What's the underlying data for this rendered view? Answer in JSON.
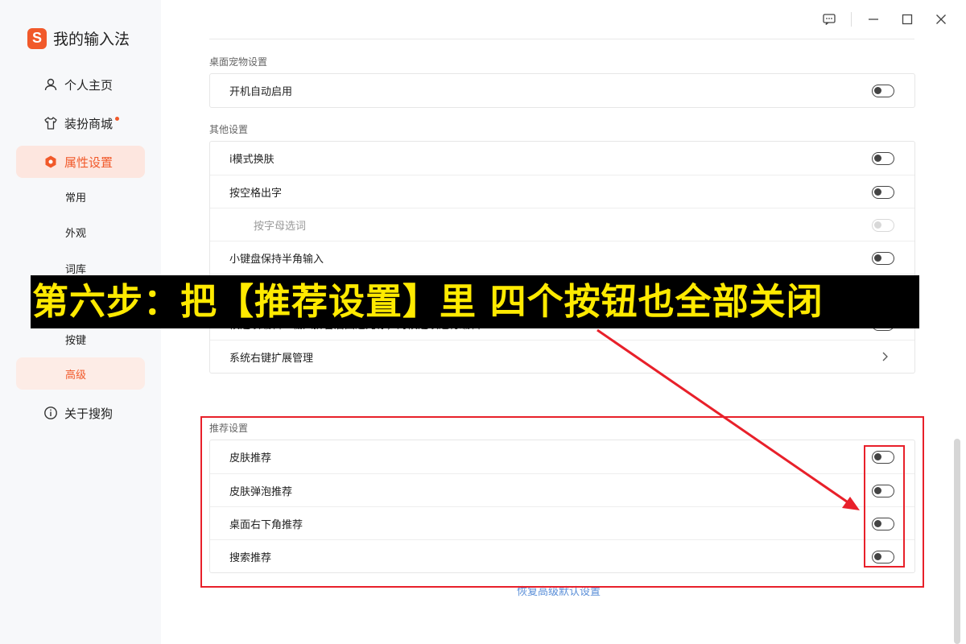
{
  "app": {
    "title": "我的输入法",
    "logo_glyph": "S"
  },
  "sidebar": {
    "items": [
      {
        "label": "个人主页",
        "icon": "user-icon"
      },
      {
        "label": "装扮商城",
        "icon": "shirt-icon",
        "badge": true
      },
      {
        "label": "属性设置",
        "icon": "hexagon-settings-icon",
        "active": true
      },
      {
        "label": "关于搜狗",
        "icon": "info-icon"
      }
    ],
    "subitems": [
      {
        "label": "常用"
      },
      {
        "label": "外观"
      },
      {
        "label": "词库"
      },
      {
        "label": "按键"
      },
      {
        "label": "高级",
        "active": true
      }
    ]
  },
  "titlebar": {
    "icons": [
      "feedback-icon",
      "minimize-icon",
      "maximize-icon",
      "close-icon"
    ]
  },
  "sections": {
    "desktop_pet": {
      "title": "桌面宠物设置",
      "rows": [
        {
          "label": "开机自动启用",
          "control": "toggle",
          "state": "off"
        }
      ]
    },
    "other": {
      "title": "其他设置",
      "rows_top": [
        {
          "label": "i模式换肤",
          "control": "toggle",
          "state": "off"
        },
        {
          "label": "按空格出字",
          "control": "toggle",
          "state": "off"
        },
        {
          "label": "按字母选词",
          "control": "toggle",
          "state": "disabled"
        },
        {
          "label": "小键盘保持半角输入",
          "control": "toggle",
          "state": "off"
        }
      ],
      "rows_bottom": [
        {
          "label": "候选项编辑：输入拼音后回退光标，对候选项进行编辑",
          "control": "toggle",
          "state": "off"
        },
        {
          "label": "系统右键扩展管理",
          "control": "chevron"
        }
      ]
    },
    "recommend": {
      "title": "推荐设置",
      "rows": [
        {
          "label": "皮肤推荐",
          "control": "toggle",
          "state": "off"
        },
        {
          "label": "皮肤弹泡推荐",
          "control": "toggle",
          "state": "off"
        },
        {
          "label": "桌面右下角推荐",
          "control": "toggle",
          "state": "off"
        },
        {
          "label": "搜索推荐",
          "control": "toggle",
          "state": "off"
        }
      ]
    }
  },
  "footer": {
    "restore_link": "恢复高级默认设置"
  },
  "annotation": {
    "banner_text": "第六步：把【推荐设置】里 四个按钮也全部关闭",
    "banner_color": "#ffea00",
    "highlight_color": "#e8202a"
  }
}
